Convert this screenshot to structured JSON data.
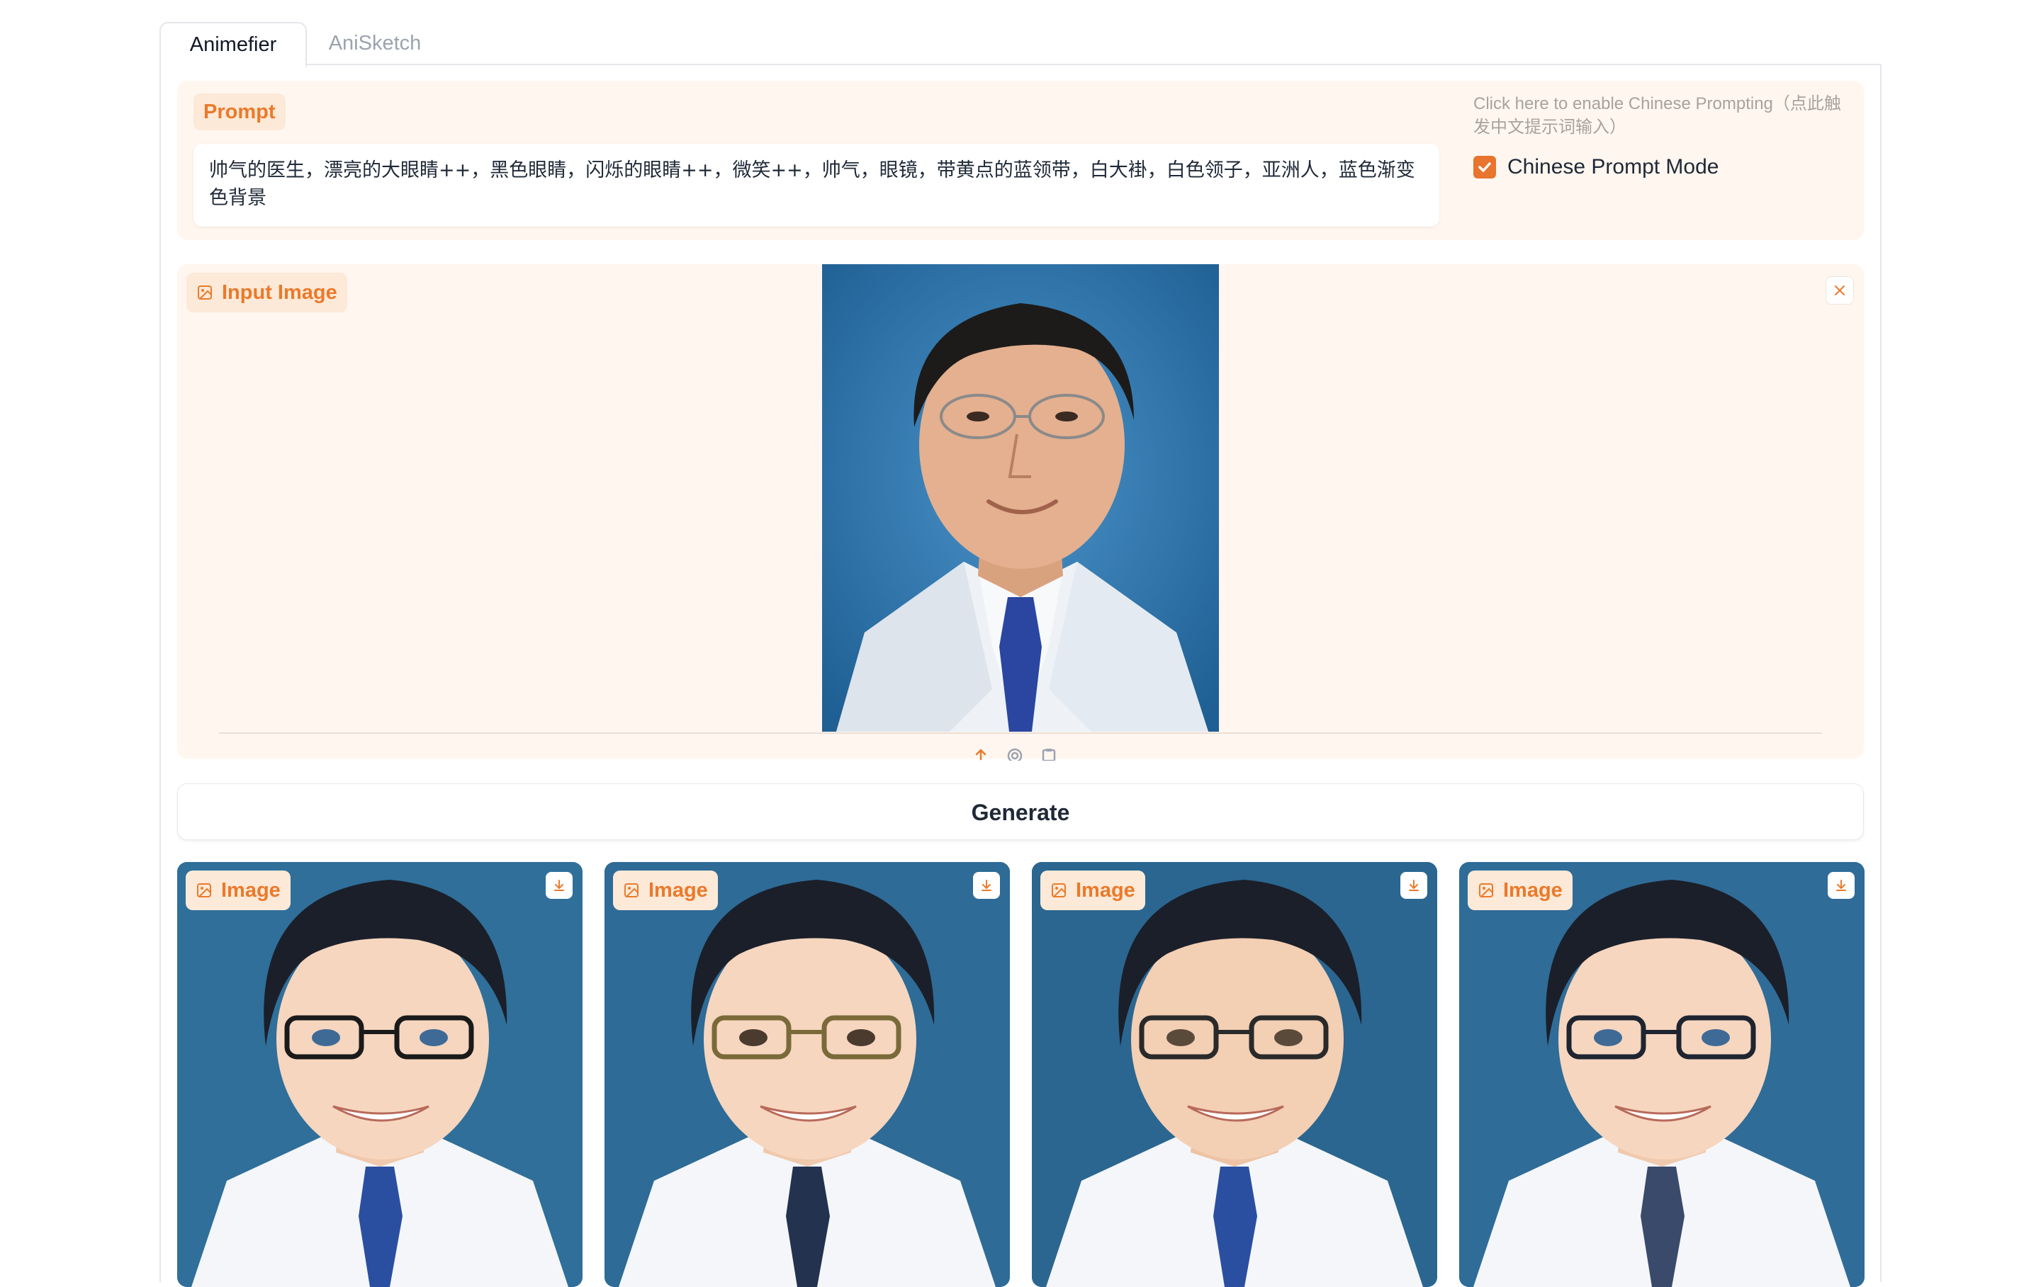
{
  "tabs": [
    {
      "label": "Animefier",
      "active": true
    },
    {
      "label": "AniSketch",
      "active": false
    }
  ],
  "prompt": {
    "label": "Prompt",
    "value": "帅气的医生，漂亮的大眼睛++，黑色眼睛，闪烁的眼睛++，微笑++，帅气，眼镜，带黄点的蓝领带，白大褂，白色领子，亚洲人，蓝色渐变色背景"
  },
  "chinese_mode": {
    "hint": "Click here to enable Chinese Prompting（点此触发中文提示词输入）",
    "checkbox_label": "Chinese Prompt Mode",
    "checked": true
  },
  "input_image": {
    "label": "Input Image",
    "icons": [
      "upload-icon",
      "webcam-icon",
      "clipboard-icon",
      "close-icon"
    ]
  },
  "generate": {
    "label": "Generate"
  },
  "outputs": [
    {
      "label": "Image",
      "glasses_color": "#1a1a1a"
    },
    {
      "label": "Image",
      "glasses_color": "#7a6a3a"
    },
    {
      "label": "Image",
      "glasses_color": "#2a2a2a"
    },
    {
      "label": "Image",
      "glasses_color": "#1e2430"
    }
  ],
  "colors": {
    "accent": "#e8742e",
    "panel_bg": "#fff6ef",
    "badge_bg": "#fde9d7",
    "photo_bg": "#2f6f9a"
  }
}
